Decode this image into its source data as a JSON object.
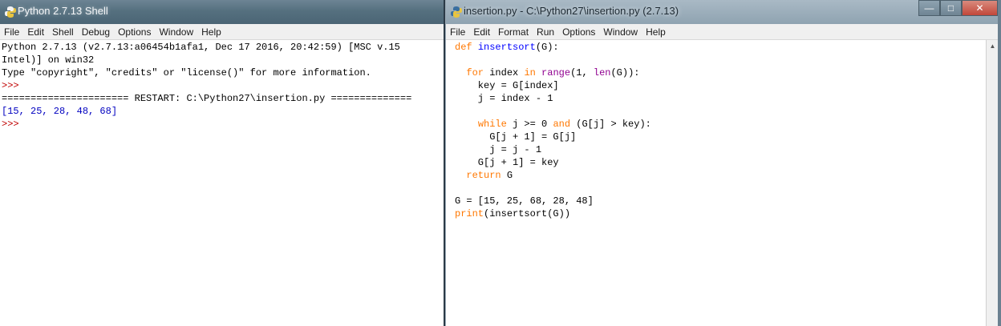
{
  "shell": {
    "title": "Python 2.7.13 Shell",
    "menu": [
      "File",
      "Edit",
      "Shell",
      "Debug",
      "Options",
      "Window",
      "Help"
    ],
    "lines": [
      {
        "kind": "out",
        "text": "Python 2.7.13 (v2.7.13:a06454b1afa1, Dec 17 2016, 20:42:59) [MSC v.15"
      },
      {
        "kind": "out",
        "text": "Intel)] on win32"
      },
      {
        "kind": "out",
        "text": "Type \"copyright\", \"credits\" or \"license()\" for more information."
      },
      {
        "kind": "prompt",
        "text": ">>> "
      },
      {
        "kind": "restart",
        "text": "====================== RESTART: C:\\Python27\\insertion.py =============="
      },
      {
        "kind": "result",
        "text": "[15, 25, 28, 48, 68]"
      },
      {
        "kind": "prompt",
        "text": ">>> "
      }
    ]
  },
  "editor": {
    "title": "insertion.py - C:\\Python27\\insertion.py (2.7.13)",
    "menu": [
      "File",
      "Edit",
      "Format",
      "Run",
      "Options",
      "Window",
      "Help"
    ],
    "window_buttons": {
      "minimize": "—",
      "maximize": "□",
      "close": "✕"
    },
    "lines": [
      [
        {
          "c": "kw",
          "t": "def "
        },
        {
          "c": "fn",
          "t": "insertsort"
        },
        {
          "c": "tx",
          "t": "(G):"
        }
      ],
      [],
      [
        {
          "c": "tx",
          "t": "  "
        },
        {
          "c": "kw",
          "t": "for"
        },
        {
          "c": "tx",
          "t": " index "
        },
        {
          "c": "kw",
          "t": "in"
        },
        {
          "c": "tx",
          "t": " "
        },
        {
          "c": "bi",
          "t": "range"
        },
        {
          "c": "tx",
          "t": "(1, "
        },
        {
          "c": "bi",
          "t": "len"
        },
        {
          "c": "tx",
          "t": "(G)):"
        }
      ],
      [
        {
          "c": "tx",
          "t": "    key = G[index]"
        }
      ],
      [
        {
          "c": "tx",
          "t": "    j = index - 1"
        }
      ],
      [],
      [
        {
          "c": "tx",
          "t": "    "
        },
        {
          "c": "kw",
          "t": "while"
        },
        {
          "c": "tx",
          "t": " j >= 0 "
        },
        {
          "c": "kw",
          "t": "and"
        },
        {
          "c": "tx",
          "t": " (G[j] > key):"
        }
      ],
      [
        {
          "c": "tx",
          "t": "      G[j + 1] = G[j]"
        }
      ],
      [
        {
          "c": "tx",
          "t": "      j = j - 1"
        }
      ],
      [
        {
          "c": "tx",
          "t": "    G[j + 1] = key"
        }
      ],
      [
        {
          "c": "tx",
          "t": "  "
        },
        {
          "c": "kw",
          "t": "return"
        },
        {
          "c": "tx",
          "t": " G"
        }
      ],
      [],
      [
        {
          "c": "tx",
          "t": "G = [15, 25, 68, 28, 48]"
        }
      ],
      [
        {
          "c": "kw",
          "t": "print"
        },
        {
          "c": "tx",
          "t": "(insertsort(G))"
        }
      ]
    ]
  }
}
